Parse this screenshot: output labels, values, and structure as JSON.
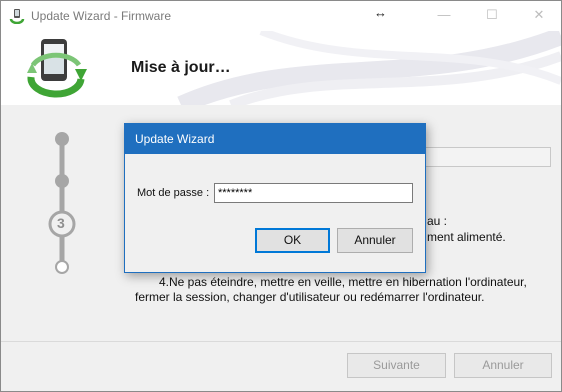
{
  "window": {
    "title": "Update Wizard - Firmware",
    "resize_glyph": "↔",
    "minimize_glyph": "—",
    "maximize_glyph": "☐",
    "close_glyph": "✕"
  },
  "header": {
    "title": "Mise à jour…",
    "logo_icon": "phone-sync-icon"
  },
  "steps": {
    "current": 3,
    "total": 4,
    "current_label": "3"
  },
  "background_text": {
    "line_1_suffix": "au :",
    "line_2_suffix": "ment alimenté.",
    "line_4a": "4.Ne pas éteindre, mettre en veille, mettre en hibernation l'ordinateur,",
    "line_4b": "fermer la session, changer d'utilisateur ou redémarrer l'ordinateur."
  },
  "footer": {
    "next_label": "Suivante",
    "cancel_label": "Annuler"
  },
  "dialog": {
    "title": "Update Wizard",
    "password_label": "Mot de passe :",
    "password_value": "********",
    "ok_label": "OK",
    "cancel_label": "Annuler"
  },
  "colors": {
    "accent": "#1f6fbf",
    "step_gray": "#a6a6a6",
    "logo_green": "#3fa535"
  }
}
